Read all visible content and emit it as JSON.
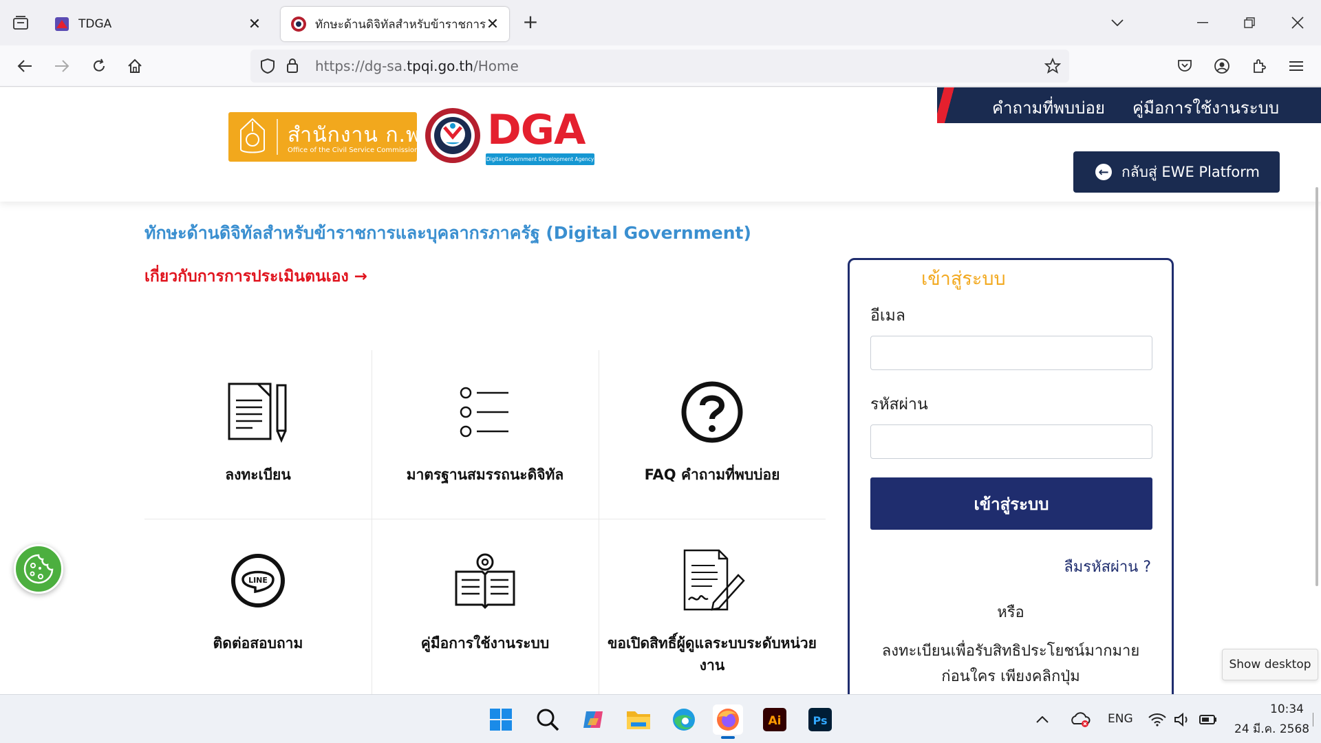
{
  "browser": {
    "tabs": [
      {
        "title": "TDGA",
        "active": false
      },
      {
        "title": "ทักษะด้านดิจิทัลสำหรับข้าราชการแ",
        "active": true
      }
    ],
    "url_prefix": "https://dg-sa.",
    "url_domain": "tpqi.go.th",
    "url_path": "/Home"
  },
  "header": {
    "ocsc_name": "สำนักงาน ก.พ.",
    "ocsc_sub": "Office of the Civil Service Commission",
    "dga_name": "DGA",
    "dga_sub": "Digital Government Development Agency",
    "menu": [
      "คำถามที่พบบ่อย",
      "คู่มือการใช้งานระบบ"
    ],
    "back_button": "กลับสู่ EWE Platform"
  },
  "main": {
    "title": "ทักษะด้านดิจิทัลสำหรับข้าราชการและบุคลากรภาครัฐ (Digital Government)",
    "about_link": "เกี่ยวกับการการประเมินตนเอง →",
    "tiles": [
      {
        "label": "ลงทะเบียน",
        "icon": "document-pen-icon"
      },
      {
        "label": "มาตรฐานสมรรถนะดิจิทัล",
        "icon": "list-icon"
      },
      {
        "label": "FAQ คำถามที่พบบ่อย",
        "icon": "question-icon"
      },
      {
        "label": "ติดต่อสอบถาม",
        "icon": "line-icon"
      },
      {
        "label": "คู่มือการใช้งานระบบ",
        "icon": "manual-book-icon"
      },
      {
        "label": "ขอเปิดสิทธิ์ผู้ดูแลระบบระดับหน่วยงาน",
        "icon": "contract-sign-icon"
      }
    ]
  },
  "login": {
    "title": "เข้าสู่ระบบ",
    "email_label": "อีเมล",
    "email_value": "",
    "password_label": "รหัสผ่าน",
    "password_value": "",
    "submit": "เข้าสู่ระบบ",
    "forgot": "ลืมรหัสผ่าน ?",
    "or": "หรือ",
    "register_line1": "ลงทะเบียนเพื่อรับสิทธิประโยชน์มากมาย",
    "register_line2": "ก่อนใคร เพียงคลิกปุ่ม"
  },
  "tooltip": "Show desktop",
  "taskbar": {
    "lang": "ENG",
    "time": "10:34",
    "date": "24 มี.ค. 2568"
  },
  "colors": {
    "navy": "#1a2b50",
    "login_navy": "#1f2d6e",
    "red": "#e4202e",
    "orange": "#f2a81d",
    "title_blue": "#3a8fd0"
  }
}
